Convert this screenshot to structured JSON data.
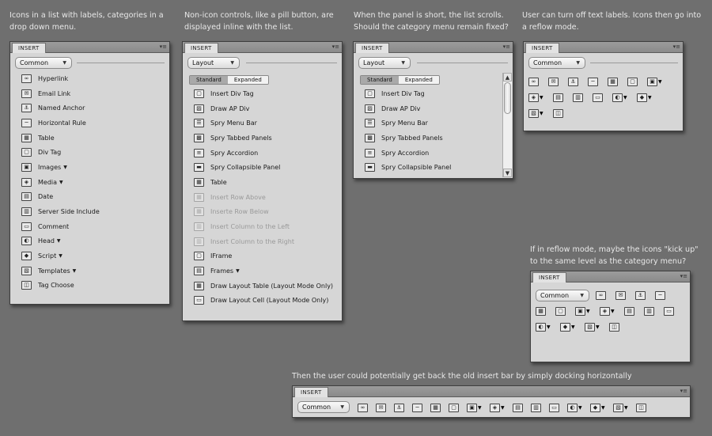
{
  "notes": {
    "n1": "Icons in a list with labels, categories in a drop down menu.",
    "n2": "Non-icon controls, like a pill button, are displayed inline with the list.",
    "n3": "When the panel is short, the list scrolls. Should the category menu remain fixed?",
    "n4": "User can turn off text labels. Icons then go into a reflow mode.",
    "n5": "If in reflow mode, maybe the icons \"kick up\" to the same level as the category menu?",
    "n6": "Then the user could potentially get back the old insert bar by simply docking horizontally"
  },
  "panel_tab": "INSERT",
  "menu_glyph": "▾≡",
  "caret": "▼",
  "panel1": {
    "category": "Common",
    "items": [
      {
        "label": "Hyperlink",
        "icon": "hyperlink-icon"
      },
      {
        "label": "Email Link",
        "icon": "email-icon"
      },
      {
        "label": "Named Anchor",
        "icon": "anchor-icon"
      },
      {
        "label": "Horizontal Rule",
        "icon": "hr-icon"
      },
      {
        "label": "Table",
        "icon": "table-icon"
      },
      {
        "label": "Div Tag",
        "icon": "div-icon"
      },
      {
        "label": "Images",
        "icon": "image-icon",
        "arrow": "▼"
      },
      {
        "label": "Media",
        "icon": "media-icon",
        "arrow": "▼"
      },
      {
        "label": "Date",
        "icon": "date-icon"
      },
      {
        "label": "Server Side Include",
        "icon": "ssi-icon"
      },
      {
        "label": "Comment",
        "icon": "comment-icon"
      },
      {
        "label": "Head",
        "icon": "head-icon",
        "arrow": "▼"
      },
      {
        "label": "Script",
        "icon": "script-icon",
        "arrow": "▼"
      },
      {
        "label": "Templates",
        "icon": "templates-icon",
        "arrow": "▼"
      },
      {
        "label": "Tag Choose",
        "icon": "tag-icon"
      }
    ]
  },
  "panel2": {
    "category": "Layout",
    "pill": [
      "Standard",
      "Expanded"
    ],
    "items": [
      {
        "label": "Insert Div Tag",
        "icon": "div-icon"
      },
      {
        "label": "Draw AP Div",
        "icon": "apdiv-icon"
      },
      {
        "label": "Spry Menu Bar",
        "icon": "menubar-icon"
      },
      {
        "label": "Spry Tabbed Panels",
        "icon": "tabbed-icon"
      },
      {
        "label": "Spry Accordion",
        "icon": "accordion-icon"
      },
      {
        "label": "Spry Collapsible Panel",
        "icon": "collapsible-icon"
      },
      {
        "label": "Table",
        "icon": "table-icon"
      },
      {
        "label": "Insert Row Above",
        "icon": "row-above-icon",
        "disabled": true
      },
      {
        "label": "Inserte Row Below",
        "icon": "row-below-icon",
        "disabled": true
      },
      {
        "label": "Insert Column to the Left",
        "icon": "col-left-icon",
        "disabled": true
      },
      {
        "label": "Insert Column to the Right",
        "icon": "col-right-icon",
        "disabled": true
      },
      {
        "label": "IFrame",
        "icon": "iframe-icon"
      },
      {
        "label": "Frames",
        "icon": "frames-icon",
        "arrow": "▼"
      },
      {
        "label": "Draw Layout Table (Layout Mode Only)",
        "icon": "layout-table-icon"
      },
      {
        "label": "Draw Layout Cell (Layout Mode Only)",
        "icon": "layout-cell-icon"
      }
    ]
  },
  "panel3": {
    "category": "Layout",
    "pill": [
      "Standard",
      "Expanded"
    ],
    "items": [
      {
        "label": "Insert Div Tag",
        "icon": "div-icon"
      },
      {
        "label": "Draw AP Div",
        "icon": "apdiv-icon"
      },
      {
        "label": "Spry Menu Bar",
        "icon": "menubar-icon"
      },
      {
        "label": "Spry Tabbed Panels",
        "icon": "tabbed-icon"
      },
      {
        "label": "Spry Accordion",
        "icon": "accordion-icon"
      },
      {
        "label": "Spry Collapsible Panel",
        "icon": "collapsible-icon"
      }
    ],
    "scroll_up": "▲",
    "scroll_down": "▼"
  },
  "panel4": {
    "category": "Common"
  },
  "panel5": {
    "category": "Common"
  },
  "panel6": {
    "category": "Common"
  },
  "reflow_icons": [
    {
      "icon": "hyperlink-icon"
    },
    {
      "icon": "email-icon"
    },
    {
      "icon": "anchor-icon"
    },
    {
      "icon": "hr-icon"
    },
    {
      "icon": "table-icon"
    },
    {
      "icon": "div-icon"
    },
    {
      "icon": "image-icon",
      "arrow": "▼"
    },
    {
      "icon": "media-icon",
      "arrow": "▼"
    },
    {
      "icon": "date-icon"
    },
    {
      "icon": "ssi-icon"
    },
    {
      "icon": "comment-icon"
    },
    {
      "icon": "head-icon",
      "arrow": "▼"
    },
    {
      "icon": "script-icon",
      "arrow": "▼"
    },
    {
      "icon": "templates-icon",
      "arrow": "▼"
    },
    {
      "icon": "tag-icon"
    }
  ]
}
